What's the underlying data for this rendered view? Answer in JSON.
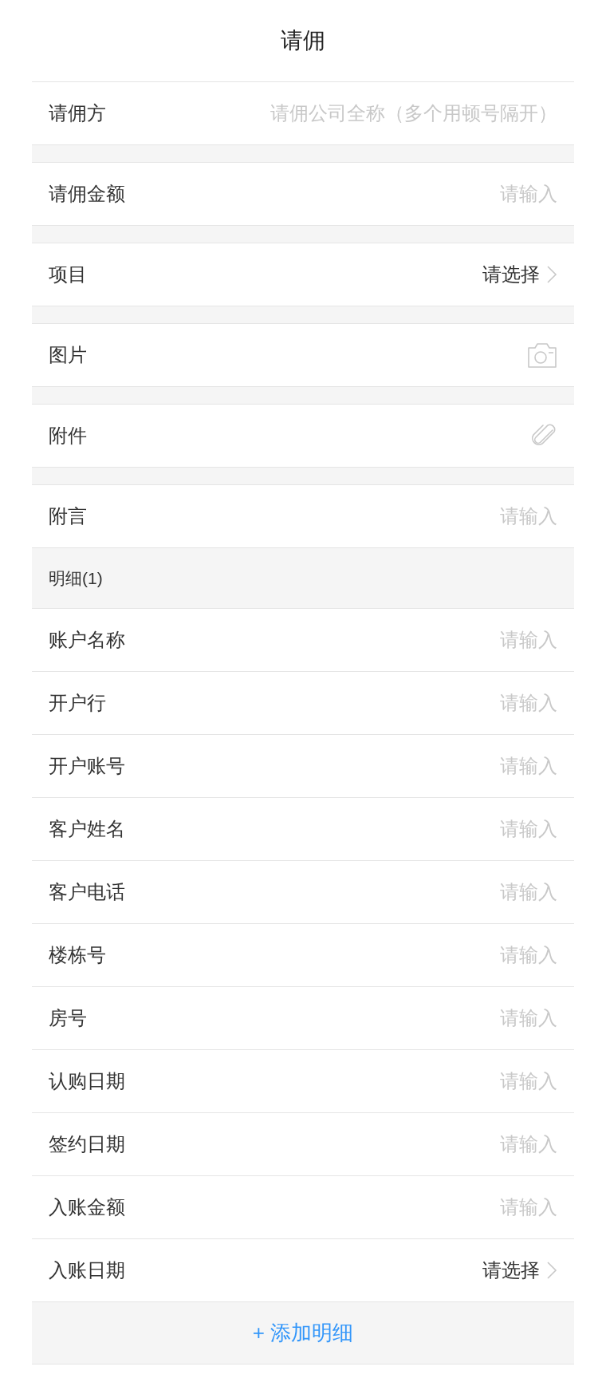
{
  "title": "请佣",
  "fields": [
    {
      "kind": "input",
      "label": "请佣方",
      "placeholder": "请佣公司全称（多个用顿号隔开）"
    },
    {
      "kind": "input",
      "label": "请佣金额",
      "placeholder": "请输入"
    },
    {
      "kind": "select",
      "label": "项目",
      "value": "请选择"
    },
    {
      "kind": "photo",
      "label": "图片"
    },
    {
      "kind": "attachment",
      "label": "附件"
    },
    {
      "kind": "input",
      "label": "附言",
      "placeholder": "请输入"
    }
  ],
  "detail": {
    "heading": "明细(1)",
    "rows": [
      {
        "kind": "input",
        "label": "账户名称",
        "placeholder": "请输入"
      },
      {
        "kind": "input",
        "label": "开户行",
        "placeholder": "请输入"
      },
      {
        "kind": "input",
        "label": "开户账号",
        "placeholder": "请输入"
      },
      {
        "kind": "input",
        "label": "客户姓名",
        "placeholder": "请输入"
      },
      {
        "kind": "input",
        "label": "客户电话",
        "placeholder": "请输入"
      },
      {
        "kind": "input",
        "label": "楼栋号",
        "placeholder": "请输入"
      },
      {
        "kind": "input",
        "label": "房号",
        "placeholder": "请输入"
      },
      {
        "kind": "input",
        "label": "认购日期",
        "placeholder": "请输入"
      },
      {
        "kind": "input",
        "label": "签约日期",
        "placeholder": "请输入"
      },
      {
        "kind": "input",
        "label": "入账金额",
        "placeholder": "请输入"
      },
      {
        "kind": "select",
        "label": "入账日期",
        "value": "请选择"
      }
    ],
    "add_button": "+ 添加明细"
  }
}
